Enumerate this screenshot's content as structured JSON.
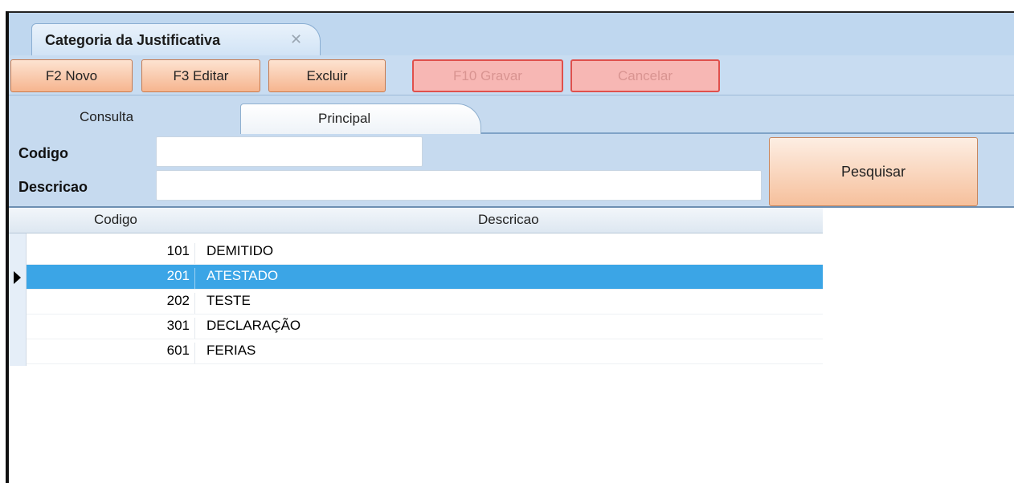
{
  "document_tab": {
    "title": "Categoria da Justificativa",
    "close_glyph": "✕"
  },
  "toolbar": {
    "novo": "F2 Novo",
    "editar": "F3 Editar",
    "excluir": "Excluir",
    "gravar": "F10 Gravar",
    "cancelar": "Cancelar"
  },
  "subtabs": {
    "consulta": "Consulta",
    "principal": "Principal"
  },
  "search": {
    "codigo_label": "Codigo",
    "codigo_value": "",
    "descricao_label": "Descricao",
    "descricao_value": "",
    "button": "Pesquisar"
  },
  "grid": {
    "columns": [
      "Codigo",
      "Descricao"
    ],
    "rows": [
      {
        "code": "101",
        "desc": "DEMITIDO",
        "selected": false
      },
      {
        "code": "201",
        "desc": "ATESTADO",
        "selected": true
      },
      {
        "code": "202",
        "desc": "TESTE",
        "selected": false
      },
      {
        "code": "301",
        "desc": "DECLARAÇÃO",
        "selected": false
      },
      {
        "code": "601",
        "desc": "FERIAS",
        "selected": false
      }
    ]
  },
  "colors": {
    "selection": "#3ba5e6",
    "panel": "#c6daef",
    "active_button": "#f6b58f",
    "disabled_button": "#f7b7b4"
  }
}
